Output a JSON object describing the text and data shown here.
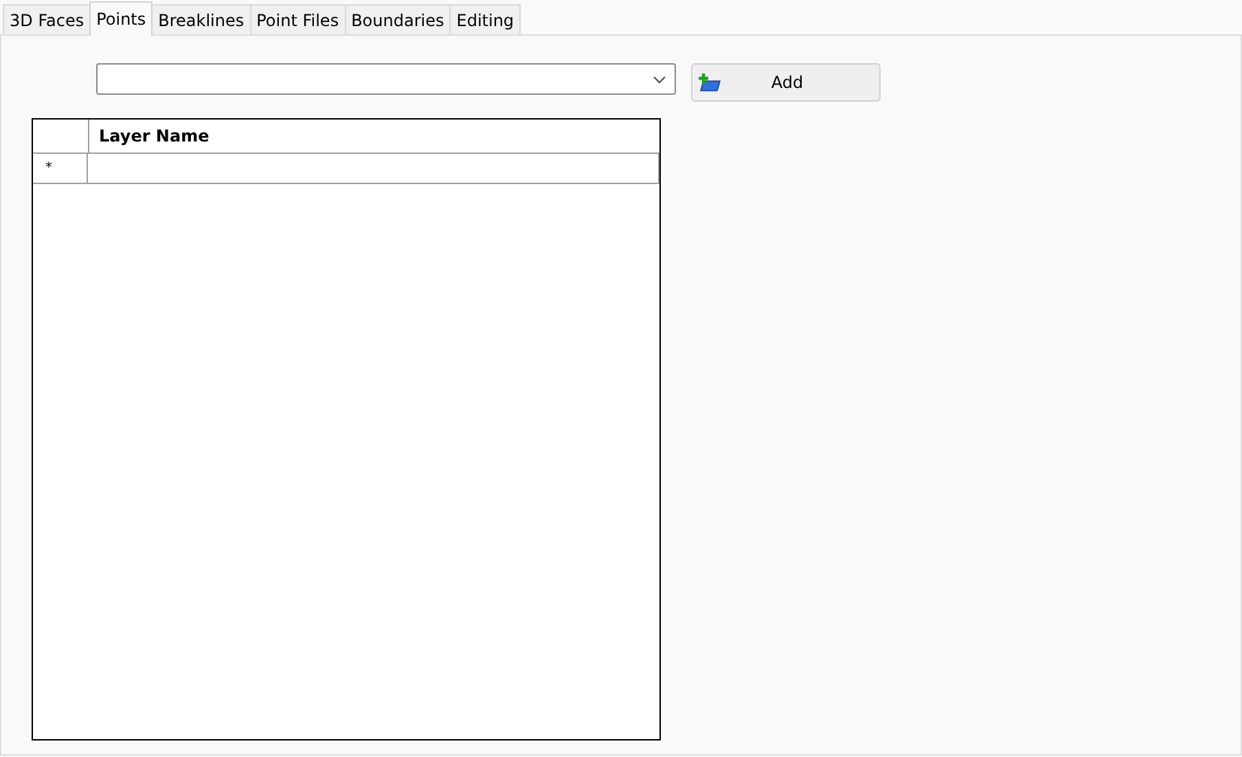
{
  "tabs": [
    {
      "label": "3D Faces",
      "selected": false
    },
    {
      "label": "Points",
      "selected": true
    },
    {
      "label": "Breaklines",
      "selected": false
    },
    {
      "label": "Point Files",
      "selected": false
    },
    {
      "label": "Boundaries",
      "selected": false
    },
    {
      "label": "Editing",
      "selected": false
    }
  ],
  "add_button": {
    "label": "Add"
  },
  "grid": {
    "columns": [
      "Layer Name"
    ],
    "rows": [
      {
        "marker": "*"
      }
    ]
  }
}
